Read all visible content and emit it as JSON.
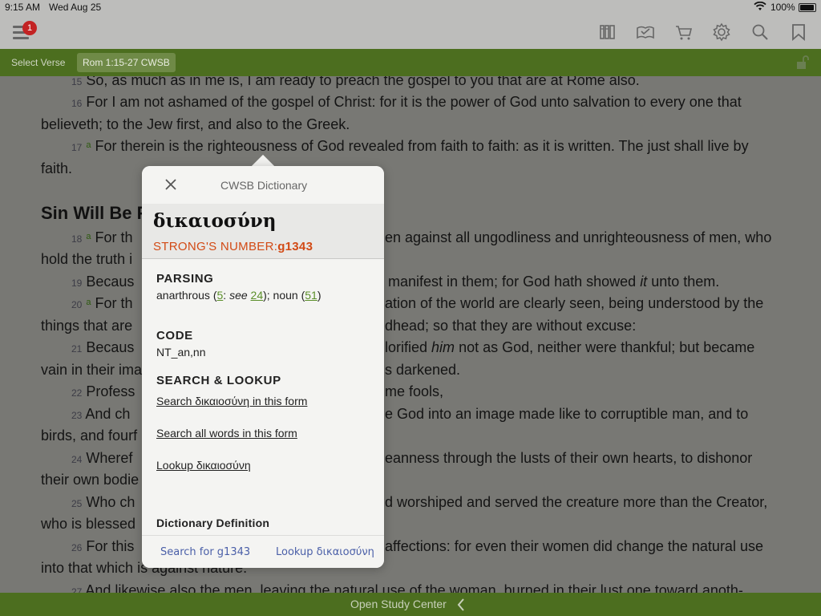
{
  "status": {
    "time": "9:15 AM",
    "date": "Wed Aug 25",
    "battery": "100%"
  },
  "toolbar": {
    "badge_count": "1",
    "icons": [
      "library-icon",
      "reading-plan-icon",
      "cart-icon",
      "settings-icon",
      "search-icon",
      "bookmark-icon"
    ]
  },
  "nav": {
    "select_verse": "Select Verse",
    "reference": "Rom 1:15-27 CWSB"
  },
  "reader": {
    "lines": [
      {
        "num": "15",
        "text": "So, as much as in me is, I am ready to preach the gospel to you that are at Rome also."
      },
      {
        "num": "16",
        "text": "For I am not ashamed of the gospel of Christ: for it is the power of God unto salvation to every one that"
      },
      {
        "text": "believeth; to the Jew first, and also to the Greek."
      },
      {
        "num": "17",
        "fn": "a",
        "text": "For therein is the righteousness of God revealed from faith to faith: as it is written. The just shall live by"
      },
      {
        "text": "faith."
      },
      {
        "num": "18",
        "fn": "a",
        "text": "For th",
        "rest": "en against all ungodliness and unrighteousness of men, who"
      },
      {
        "text": "hold the truth i"
      },
      {
        "num": "19",
        "text": "Becaus",
        "rest": "manifest in them; for God hath showed",
        "it": "it",
        "rest2": "unto them."
      },
      {
        "num": "20",
        "fn": "a",
        "text": "For th",
        "rest": "ation of the world are clearly seen, being understood by the"
      },
      {
        "text": "things that are",
        "rest": "dhead; so that they are without excuse:"
      },
      {
        "num": "21",
        "text": "Becaus",
        "rest": "lorified",
        "it": "him",
        "rest2": "not as God, neither were thankful; but became"
      },
      {
        "text": "vain in their ima",
        "rest": "s darkened."
      },
      {
        "num": "22",
        "text": "Profess",
        "rest": "me fools,"
      },
      {
        "num": "23",
        "text": "And ch",
        "rest": "e God into an image made like to corruptible man, and to"
      },
      {
        "text": "birds, and fourf"
      },
      {
        "num": "24",
        "text": "Wheref",
        "rest": "eanness through the lusts of their own hearts, to dishonor"
      },
      {
        "text": "their own bodie"
      },
      {
        "num": "25",
        "text": "Who ch",
        "rest": "d worshiped and served the creature more than the Creator,"
      },
      {
        "text": "who is blessed"
      },
      {
        "num": "26",
        "text": "For this",
        "rest": "affections: for even their women did change the natural use"
      },
      {
        "text": "into that which is against nature."
      },
      {
        "num": "27",
        "text": "And likewise also the men, leaving the natural use of the woman, burned in their lust one toward anoth-"
      }
    ],
    "heading": "Sin Will Be P"
  },
  "popup": {
    "title": "CWSB Dictionary",
    "lemma": "δικαιοσύνη",
    "strongs_label": "STRONG'S NUMBER:",
    "strongs_value": "g1343",
    "parsing_title": "PARSING",
    "parsing": {
      "pre": "anarthrous (",
      "l1": "5",
      "mid1": ": ",
      "see": "see",
      "l2": "24",
      "mid2": "); noun (",
      "l3": "51",
      "post": ")"
    },
    "code_title": "CODE",
    "code": "NT_an,nn",
    "search_title": "SEARCH & LOOKUP",
    "link_search_form": "Search δικαιοσύνη in this form",
    "link_search_all": "Search all words in this form",
    "link_lookup": "Lookup δικαιοσύνη",
    "definition_title": "Dictionary Definition",
    "footer_search": "Search for g1343",
    "footer_lookup": "Lookup δικαιοσύνη"
  },
  "bottom": {
    "label": "Open Study Center"
  }
}
